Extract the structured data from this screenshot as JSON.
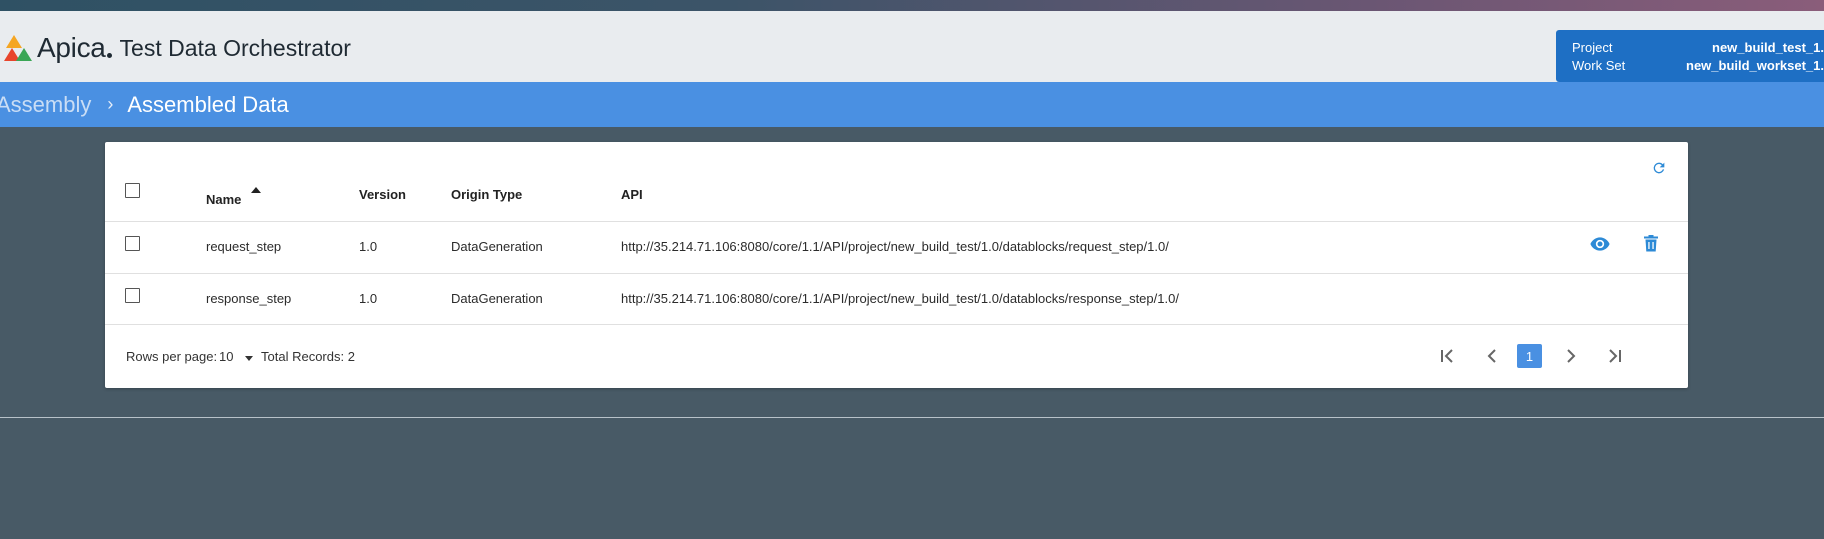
{
  "header": {
    "brand": "Apica",
    "app_title": "Test Data Orchestrator",
    "project_label": "Project",
    "project_value": "new_build_test_1.",
    "workset_label": "Work Set",
    "workset_value": "new_build_workset_1."
  },
  "breadcrumb": {
    "previous": "Assembly",
    "separator": "›",
    "current": "Assembled Data"
  },
  "table": {
    "columns": {
      "name": "Name",
      "version": "Version",
      "origin_type": "Origin Type",
      "api": "API"
    },
    "sort": {
      "column": "Name",
      "direction": "ascending"
    },
    "rows": [
      {
        "name": "request_step",
        "version": "1.0",
        "origin_type": "DataGeneration",
        "api": "http://35.214.71.106:8080/core/1.1/API/project/new_build_test/1.0/datablocks/request_step/1.0/"
      },
      {
        "name": "response_step",
        "version": "1.0",
        "origin_type": "DataGeneration",
        "api": "http://35.214.71.106:8080/core/1.1/API/project/new_build_test/1.0/datablocks/response_step/1.0/"
      }
    ],
    "row_action_icons": [
      "eye-icon",
      "trash-icon"
    ]
  },
  "footer": {
    "rows_per_page_label": "Rows per page:",
    "rows_per_page_value": "10",
    "total_records": "Total Records: 2",
    "current_page": "1"
  },
  "colors": {
    "breadcrumb_bar": "#4a90e2",
    "project_box": "#1e6fc4",
    "background": "#485a66",
    "header": "#e9ecef",
    "accent": "#2d8ad6"
  }
}
